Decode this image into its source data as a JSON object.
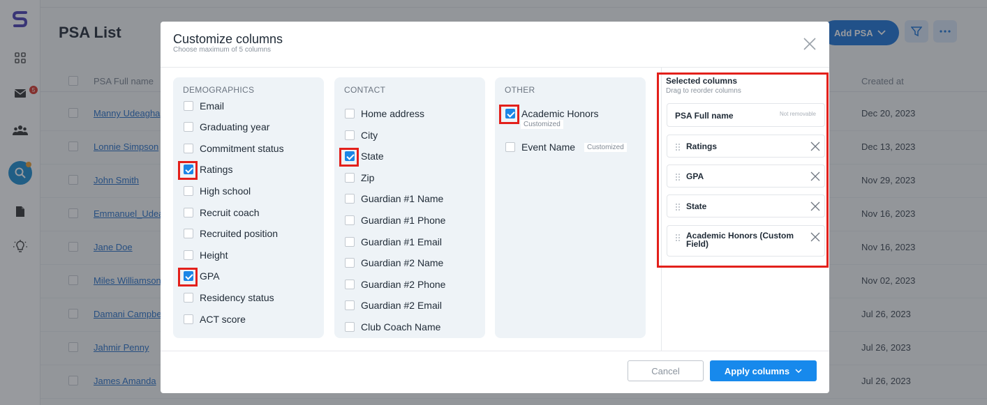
{
  "app": {
    "page_title": "PSA List",
    "add_button_label": "Add PSA",
    "mail_badge": "5",
    "table": {
      "col_name": "PSA Full name",
      "col_created": "Created at",
      "rows": [
        {
          "name": "Manny Udeagha",
          "created": "Dec 20, 2023"
        },
        {
          "name": "Lonnie Simpson",
          "created": "Dec 13, 2023"
        },
        {
          "name": "John Smith",
          "created": "Nov 29, 2023"
        },
        {
          "name": "Emmanuel_Udeagha",
          "created": "Nov 16, 2023"
        },
        {
          "name": "Jane Doe",
          "created": "Nov 16, 2023"
        },
        {
          "name": "Miles Williamson",
          "created": "Nov 02, 2023"
        },
        {
          "name": "Damani Campbell",
          "created": "Jul 26, 2023"
        },
        {
          "name": "Jahmir Penny",
          "created": "Jul 26, 2023"
        },
        {
          "name": "James Amanda",
          "created": "Jul 26, 2023"
        }
      ]
    }
  },
  "modal": {
    "title": "Customize columns",
    "subtitle": "Choose maximum of 5 columns",
    "groups": {
      "demographics": {
        "label": "DEMOGRAPHICS",
        "options": [
          {
            "label": "Email",
            "checked": false
          },
          {
            "label": "Graduating year",
            "checked": false
          },
          {
            "label": "Commitment status",
            "checked": false
          },
          {
            "label": "Ratings",
            "checked": true
          },
          {
            "label": "High school",
            "checked": false
          },
          {
            "label": "Recruit coach",
            "checked": false
          },
          {
            "label": "Recruited position",
            "checked": false
          },
          {
            "label": "Height",
            "checked": false
          },
          {
            "label": "GPA",
            "checked": true
          },
          {
            "label": "Residency status",
            "checked": false
          },
          {
            "label": "ACT score",
            "checked": false
          }
        ]
      },
      "contact": {
        "label": "CONTACT",
        "options": [
          {
            "label": "Home address",
            "checked": false
          },
          {
            "label": "City",
            "checked": false
          },
          {
            "label": "State",
            "checked": true
          },
          {
            "label": "Zip",
            "checked": false
          },
          {
            "label": "Guardian #1 Name",
            "checked": false
          },
          {
            "label": "Guardian #1 Phone",
            "checked": false
          },
          {
            "label": "Guardian #1 Email",
            "checked": false
          },
          {
            "label": "Guardian #2 Name",
            "checked": false
          },
          {
            "label": "Guardian #2 Phone",
            "checked": false
          },
          {
            "label": "Guardian #2 Email",
            "checked": false
          },
          {
            "label": "Club Coach Name",
            "checked": false
          }
        ]
      },
      "other": {
        "label": "OTHER",
        "options": [
          {
            "label": "Academic Honors",
            "checked": true,
            "tag": "Customized"
          },
          {
            "label": "Event Name",
            "checked": false,
            "tag": "Customized"
          }
        ]
      }
    },
    "selected": {
      "title": "Selected columns",
      "subtitle": "Drag to reorder columns",
      "fixed": {
        "label": "PSA Full name",
        "note": "Not removable"
      },
      "items": [
        "Ratings",
        "GPA",
        "State",
        "Academic Honors (Custom Field)"
      ]
    },
    "cancel_label": "Cancel",
    "apply_label": "Apply columns"
  },
  "colors": {
    "accent": "#1789ec",
    "highlight": "#e3201b",
    "brand": "#4a3fb3"
  }
}
